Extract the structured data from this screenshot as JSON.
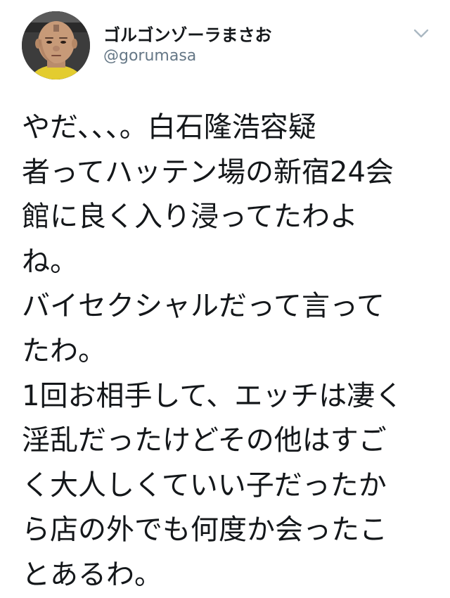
{
  "tweet": {
    "author": {
      "display_name": "ゴルゴンゾーラまさお",
      "handle": "@gorumasa"
    },
    "text": "やだ、、、。白石隆浩容疑\n者ってハッテン場の新宿24会\n館に良く入り浸ってたわよ\nね。\nバイセクシャルだって言って\nたわ。\n1回お相手して、エッチは凄く\n淫乱だったけどその他はすご\nく大人しくていい子だったか\nら店の外でも何度か会ったこ\nとあるわ。"
  },
  "icons": {
    "menu": "chevron-down-icon",
    "avatar": "profile-photo"
  },
  "colors": {
    "text": "#14171a",
    "secondary_text": "#657786",
    "icon": "#aab8c2",
    "background": "#ffffff"
  }
}
